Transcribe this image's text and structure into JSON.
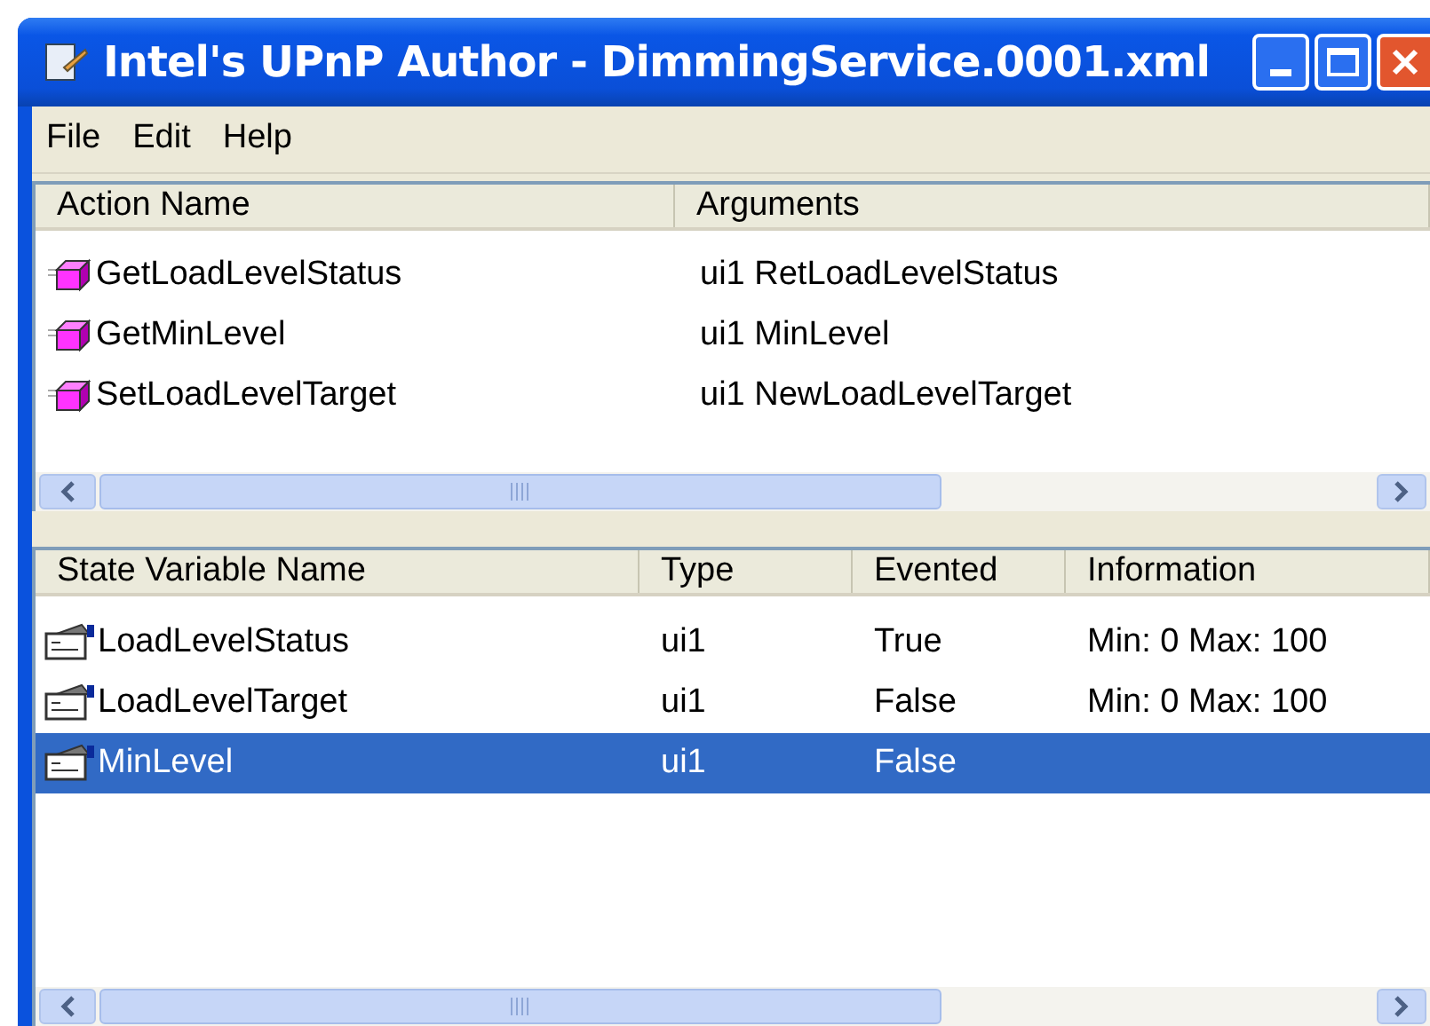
{
  "window": {
    "title": "Intel's UPnP Author - DimmingService.0001.xml"
  },
  "menu": [
    "File",
    "Edit",
    "Help"
  ],
  "actions": {
    "columns": [
      "Action Name",
      "Arguments"
    ],
    "rows": [
      {
        "name": "GetLoadLevelStatus",
        "arguments": "ui1 RetLoadLevelStatus",
        "selected": false
      },
      {
        "name": "GetMinLevel",
        "arguments": "ui1 MinLevel",
        "selected": false
      },
      {
        "name": "SetLoadLevelTarget",
        "arguments": "ui1 NewLoadLevelTarget",
        "selected": false
      }
    ]
  },
  "state_variables": {
    "columns": [
      "State Variable Name",
      "Type",
      "Evented",
      "Information"
    ],
    "rows": [
      {
        "name": "LoadLevelStatus",
        "type": "ui1",
        "evented": "True",
        "information": "Min: 0 Max: 100",
        "selected": false
      },
      {
        "name": "LoadLevelTarget",
        "type": "ui1",
        "evented": "False",
        "information": "Min: 0 Max: 100",
        "selected": false
      },
      {
        "name": "MinLevel",
        "type": "ui1",
        "evented": "False",
        "selected": true
      }
    ]
  }
}
